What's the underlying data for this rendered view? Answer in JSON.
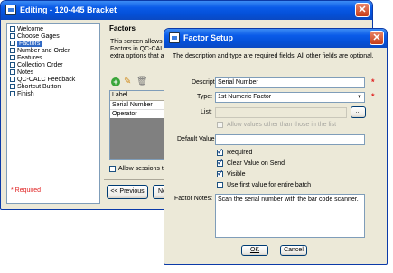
{
  "back_window": {
    "title": "Editing - 120-445 Bracket",
    "steps": [
      "Welcome",
      "Choose Gages",
      "Factors",
      "Number and Order",
      "Features",
      "Collection Order",
      "Notes",
      "QC-CALC Feedback",
      "Shortcut Button",
      "Finish"
    ],
    "selected_step": 2,
    "required_note": "* Required",
    "section_title": "Factors",
    "description_lines": [
      "This screen allows yo",
      "Factors in QC-CALC",
      "extra options that a"
    ],
    "table_header": "Label",
    "table_rows": [
      "Serial Number",
      "Operator"
    ],
    "allow_sessions_label": "Allow sessions to",
    "prev_button": "<< Previous",
    "next_button_partial": "Ne"
  },
  "dialog": {
    "title": "Factor Setup",
    "info": "The description and type are required fields. All other fields are optional.",
    "description_label": "Description:",
    "description_value": "Serial Number",
    "type_label": "Type:",
    "type_value": "1st Numeric Factor",
    "list_label": "List:",
    "browse_label": "...",
    "allow_other_label": "Allow values other than those in the list",
    "default_label": "Default Value:",
    "default_value": "",
    "checkboxes": [
      {
        "label": "Required",
        "checked": true
      },
      {
        "label": "Clear Value on Send",
        "checked": true
      },
      {
        "label": "Visible",
        "checked": true
      },
      {
        "label": "Use first value for entire batch",
        "checked": false
      }
    ],
    "notes_label": "Factor Notes:",
    "notes_value": "Scan the serial number with the bar code scanner.",
    "ok_label": "OK",
    "cancel_label": "Cancel",
    "required_mark": "*"
  }
}
